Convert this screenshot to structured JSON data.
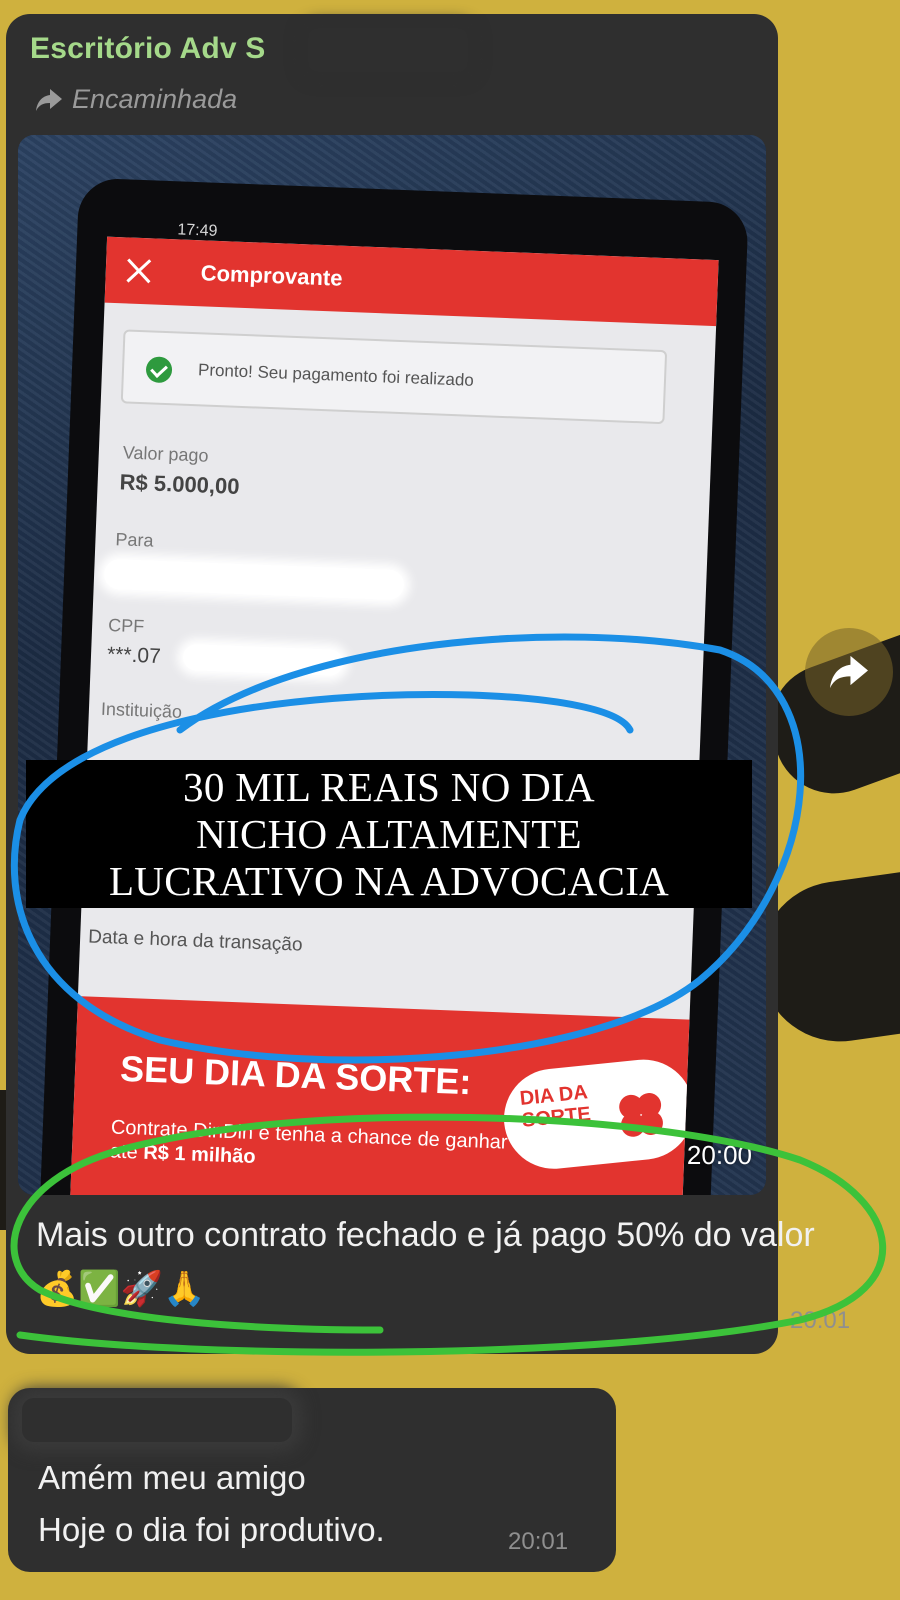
{
  "chat": {
    "message1": {
      "sender": "Escritório Adv S",
      "forwarded_label": "Encaminhada",
      "photo_time": "20:00",
      "text": "Mais outro contrato fechado e já pago 50% do valor",
      "emojis": "💰✅🚀🙏",
      "time": "20:01"
    },
    "message2": {
      "line1": "Amém meu amigo",
      "line2": "Hoje o dia foi produtivo.",
      "time": "20:01"
    },
    "share_icon": "share-arrow-icon"
  },
  "photo": {
    "statusbar_time": "17:49",
    "header_title": "Comprovante",
    "confirmation": "Pronto! Seu pagamento foi realizado",
    "amount_label": "Valor pago",
    "amount_value": "R$ 5.000,00",
    "to_label": "Para",
    "cpf_label": "CPF",
    "cpf_value": "***.07",
    "institution_label": "Instituição",
    "datetime_label": "Data e hora da transação",
    "promo_title": "SEU DIA DA SORTE:",
    "promo_sub": "Contrate DinDin e tenha a chance de ganhar até",
    "promo_sub_bold": "R$ 1 milhão",
    "badge_text_1": "DIA DA",
    "badge_text_2": "SORTE"
  },
  "overlay_caption": {
    "line1": "30 MIL REAIS NO DIA",
    "line2": "NICHO ALTAMENTE",
    "line3": "LUCRATIVO NA ADVOCACIA"
  },
  "colors": {
    "background": "#cfb13e",
    "bubble": "#2f2f2f",
    "sender_name": "#a5d98a",
    "annotation_blue": "#1b8fe6",
    "annotation_green": "#3cc23a",
    "brand_red": "#e2342f"
  }
}
